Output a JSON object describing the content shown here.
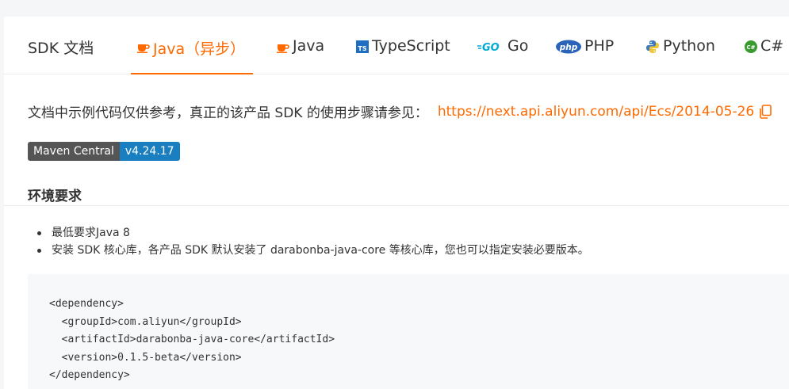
{
  "header": {
    "brand": "SDK 文档",
    "tabs": [
      {
        "label": "Java（异步）",
        "icon": "java-icon",
        "active": true
      },
      {
        "label": "Java",
        "icon": "java-icon",
        "active": false
      },
      {
        "label": "TypeScript",
        "icon": "typescript-icon",
        "active": false
      },
      {
        "label": "Go",
        "icon": "go-icon",
        "active": false
      },
      {
        "label": "PHP",
        "icon": "php-icon",
        "active": false
      },
      {
        "label": "Python",
        "icon": "python-icon",
        "active": false
      },
      {
        "label": "C#",
        "icon": "csharp-icon",
        "active": false
      }
    ]
  },
  "intro": {
    "text": "文档中示例代码仅供参考，真正的该产品 SDK 的使用步骤请参见：",
    "link": "https://next.api.aliyun.com/api/Ecs/2014-05-26"
  },
  "badge": {
    "left": "Maven Central",
    "right": "v4.24.17"
  },
  "env": {
    "heading": "环境要求",
    "items": [
      "最低要求Java 8",
      "安装 SDK 核心库，各产品 SDK 默认安装了 darabonba-java-core 等核心库，您也可以指定安装必要版本。"
    ]
  },
  "code": {
    "lines": [
      "<dependency>",
      "  <groupId>com.aliyun</groupId>",
      "  <artifactId>darabonba-java-core</artifactId>",
      "  <version>0.1.5-beta</version>",
      "</dependency>"
    ]
  },
  "colors": {
    "accent": "#ff6a00",
    "badge_left": "#555555",
    "badge_right": "#1a7fc1"
  }
}
